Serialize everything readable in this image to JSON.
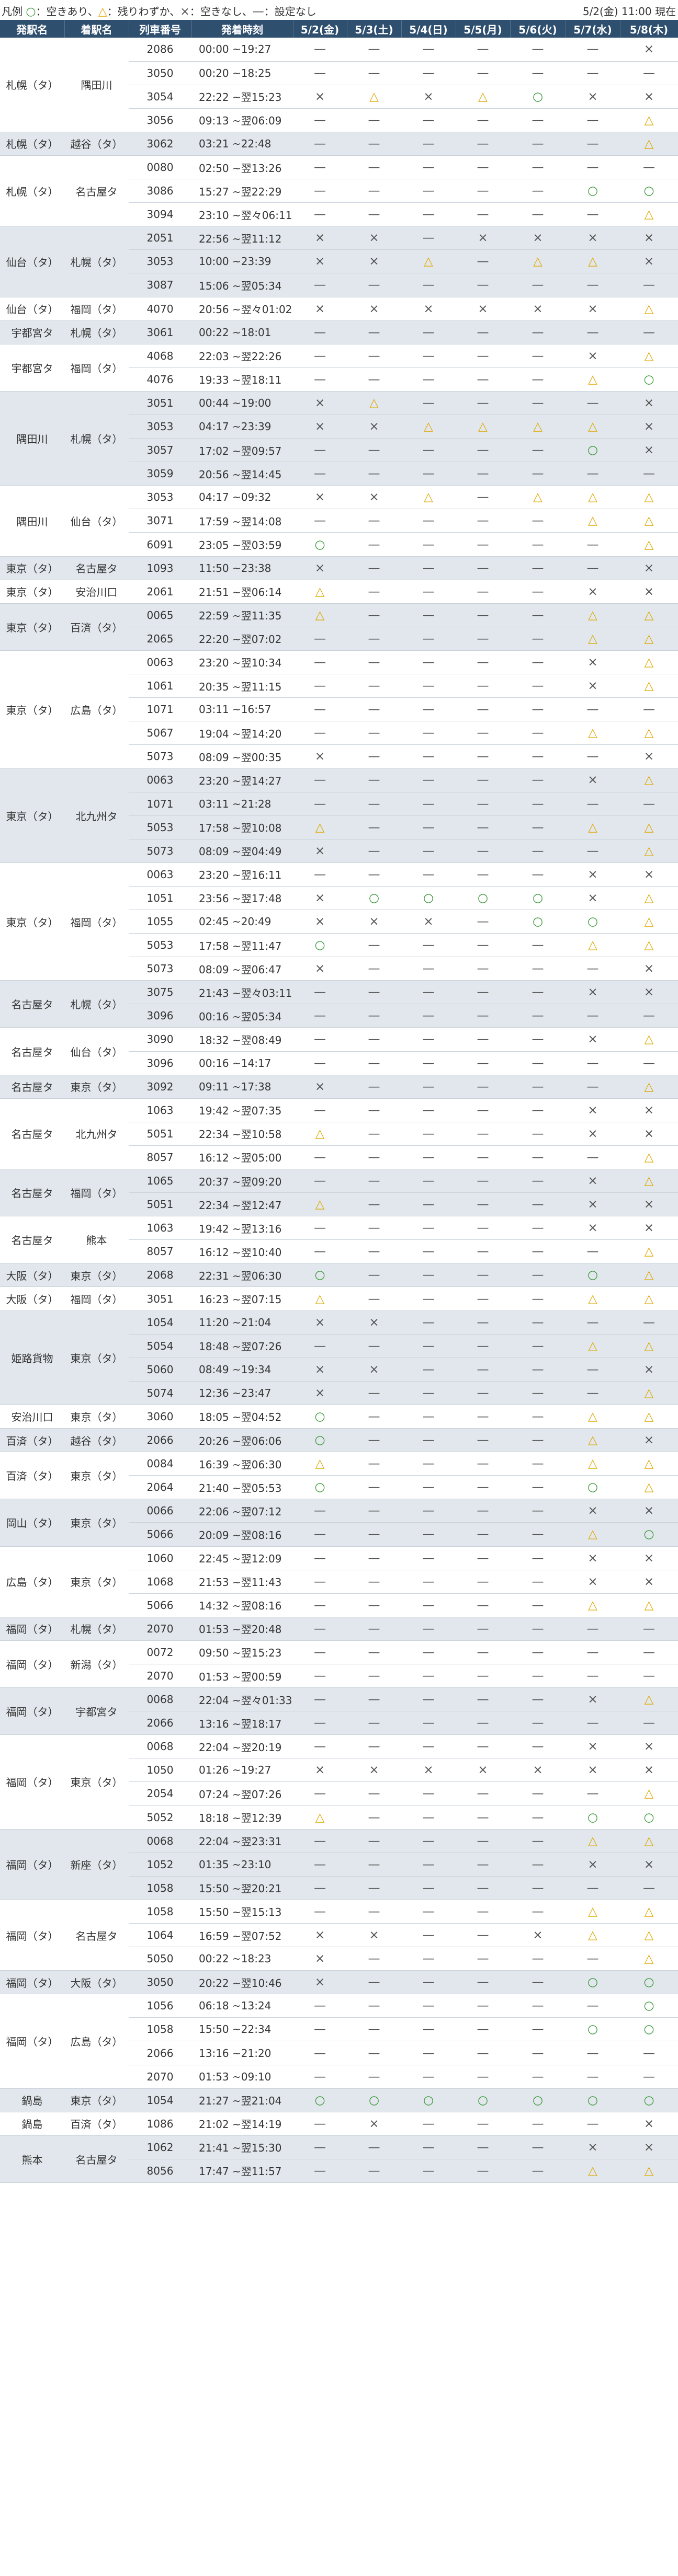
{
  "header": {
    "legend_label": "凡例",
    "legend_items": [
      {
        "symbol": "○",
        "text": "：空きあり、",
        "color": "#3b9a3b"
      },
      {
        "symbol": "△",
        "text": "：残りわずか、",
        "color": "#e0a800"
      },
      {
        "symbol": "×",
        "text": "：空きなし、",
        "color": "#555555"
      },
      {
        "symbol": "—",
        "text": "：設定なし",
        "color": "#555555"
      }
    ],
    "as_of": "5/2(金) 11:00 現在"
  },
  "columns": [
    "発駅名",
    "着駅名",
    "列車番号",
    "発着時刻",
    "5/2(金)",
    "5/3(土)",
    "5/4(日)",
    "5/5(月)",
    "5/6(火)",
    "5/7(水)",
    "5/8(木)"
  ],
  "groups": [
    {
      "from": "札幌（タ）",
      "to": "隅田川",
      "rows": [
        [
          "2086",
          "00:00 ~19:27",
          "—",
          "—",
          "—",
          "—",
          "—",
          "—",
          "×"
        ],
        [
          "3050",
          "00:20 ~18:25",
          "—",
          "—",
          "—",
          "—",
          "—",
          "—",
          "—"
        ],
        [
          "3054",
          "22:22 ~翌15:23",
          "×",
          "△",
          "×",
          "△",
          "○",
          "×",
          "×"
        ],
        [
          "3056",
          "09:13 ~翌06:09",
          "—",
          "—",
          "—",
          "—",
          "—",
          "—",
          "△"
        ]
      ]
    },
    {
      "from": "札幌（タ）",
      "to": "越谷（タ）",
      "rows": [
        [
          "3062",
          "03:21 ~22:48",
          "—",
          "—",
          "—",
          "—",
          "—",
          "—",
          "△"
        ]
      ]
    },
    {
      "from": "札幌（タ）",
      "to": "名古屋タ",
      "rows": [
        [
          "0080",
          "02:50 ~翌13:26",
          "—",
          "—",
          "—",
          "—",
          "—",
          "—",
          "—"
        ],
        [
          "3086",
          "15:27 ~翌22:29",
          "—",
          "—",
          "—",
          "—",
          "—",
          "○",
          "○"
        ],
        [
          "3094",
          "23:10 ~翌々06:11",
          "—",
          "—",
          "—",
          "—",
          "—",
          "—",
          "△"
        ]
      ]
    },
    {
      "from": "仙台（タ）",
      "to": "札幌（タ）",
      "rows": [
        [
          "2051",
          "22:56 ~翌11:12",
          "×",
          "×",
          "—",
          "×",
          "×",
          "×",
          "×"
        ],
        [
          "3053",
          "10:00 ~23:39",
          "×",
          "×",
          "△",
          "—",
          "△",
          "△",
          "×"
        ],
        [
          "3087",
          "15:06 ~翌05:34",
          "—",
          "—",
          "—",
          "—",
          "—",
          "—",
          "—"
        ]
      ]
    },
    {
      "from": "仙台（タ）",
      "to": "福岡（タ）",
      "rows": [
        [
          "4070",
          "20:56 ~翌々01:02",
          "×",
          "×",
          "×",
          "×",
          "×",
          "×",
          "△"
        ]
      ]
    },
    {
      "from": "宇都宮タ",
      "to": "札幌（タ）",
      "rows": [
        [
          "3061",
          "00:22 ~18:01",
          "—",
          "—",
          "—",
          "—",
          "—",
          "—",
          "—"
        ]
      ]
    },
    {
      "from": "宇都宮タ",
      "to": "福岡（タ）",
      "rows": [
        [
          "4068",
          "22:03 ~翌22:26",
          "—",
          "—",
          "—",
          "—",
          "—",
          "×",
          "△"
        ],
        [
          "4076",
          "19:33 ~翌18:11",
          "—",
          "—",
          "—",
          "—",
          "—",
          "△",
          "○"
        ]
      ]
    },
    {
      "from": "隅田川",
      "to": "札幌（タ）",
      "rows": [
        [
          "3051",
          "00:44 ~19:00",
          "×",
          "△",
          "—",
          "—",
          "—",
          "—",
          "×"
        ],
        [
          "3053",
          "04:17 ~23:39",
          "×",
          "×",
          "△",
          "△",
          "△",
          "△",
          "×"
        ],
        [
          "3057",
          "17:02 ~翌09:57",
          "—",
          "—",
          "—",
          "—",
          "—",
          "○",
          "×"
        ],
        [
          "3059",
          "20:56 ~翌14:45",
          "—",
          "—",
          "—",
          "—",
          "—",
          "—",
          "—"
        ]
      ]
    },
    {
      "from": "隅田川",
      "to": "仙台（タ）",
      "rows": [
        [
          "3053",
          "04:17 ~09:32",
          "×",
          "×",
          "△",
          "—",
          "△",
          "△",
          "△"
        ],
        [
          "3071",
          "17:59 ~翌14:08",
          "—",
          "—",
          "—",
          "—",
          "—",
          "△",
          "△"
        ],
        [
          "6091",
          "23:05 ~翌03:59",
          "○",
          "—",
          "—",
          "—",
          "—",
          "—",
          "△"
        ]
      ]
    },
    {
      "from": "東京（タ）",
      "to": "名古屋タ",
      "rows": [
        [
          "1093",
          "11:50 ~23:38",
          "×",
          "—",
          "—",
          "—",
          "—",
          "—",
          "×"
        ]
      ]
    },
    {
      "from": "東京（タ）",
      "to": "安治川口",
      "rows": [
        [
          "2061",
          "21:51 ~翌06:14",
          "△",
          "—",
          "—",
          "—",
          "—",
          "×",
          "×"
        ]
      ]
    },
    {
      "from": "東京（タ）",
      "to": "百済（タ）",
      "rows": [
        [
          "0065",
          "22:59 ~翌11:35",
          "△",
          "—",
          "—",
          "—",
          "—",
          "△",
          "△"
        ],
        [
          "2065",
          "22:20 ~翌07:02",
          "—",
          "—",
          "—",
          "—",
          "—",
          "△",
          "△"
        ]
      ]
    },
    {
      "from": "東京（タ）",
      "to": "広島（タ）",
      "rows": [
        [
          "0063",
          "23:20 ~翌10:34",
          "—",
          "—",
          "—",
          "—",
          "—",
          "×",
          "△"
        ],
        [
          "1061",
          "20:35 ~翌11:15",
          "—",
          "—",
          "—",
          "—",
          "—",
          "×",
          "△"
        ],
        [
          "1071",
          "03:11 ~16:57",
          "—",
          "—",
          "—",
          "—",
          "—",
          "—",
          "—"
        ],
        [
          "5067",
          "19:04 ~翌14:20",
          "—",
          "—",
          "—",
          "—",
          "—",
          "△",
          "△"
        ],
        [
          "5073",
          "08:09 ~翌00:35",
          "×",
          "—",
          "—",
          "—",
          "—",
          "—",
          "×"
        ]
      ]
    },
    {
      "from": "東京（タ）",
      "to": "北九州タ",
      "rows": [
        [
          "0063",
          "23:20 ~翌14:27",
          "—",
          "—",
          "—",
          "—",
          "—",
          "×",
          "△"
        ],
        [
          "1071",
          "03:11 ~21:28",
          "—",
          "—",
          "—",
          "—",
          "—",
          "—",
          "—"
        ],
        [
          "5053",
          "17:58 ~翌10:08",
          "△",
          "—",
          "—",
          "—",
          "—",
          "△",
          "△"
        ],
        [
          "5073",
          "08:09 ~翌04:49",
          "×",
          "—",
          "—",
          "—",
          "—",
          "—",
          "△"
        ]
      ]
    },
    {
      "from": "東京（タ）",
      "to": "福岡（タ）",
      "rows": [
        [
          "0063",
          "23:20 ~翌16:11",
          "—",
          "—",
          "—",
          "—",
          "—",
          "×",
          "×"
        ],
        [
          "1051",
          "23:56 ~翌17:48",
          "×",
          "○",
          "○",
          "○",
          "○",
          "×",
          "△"
        ],
        [
          "1055",
          "02:45 ~20:49",
          "×",
          "×",
          "×",
          "—",
          "○",
          "○",
          "△"
        ],
        [
          "5053",
          "17:58 ~翌11:47",
          "○",
          "—",
          "—",
          "—",
          "—",
          "△",
          "△"
        ],
        [
          "5073",
          "08:09 ~翌06:47",
          "×",
          "—",
          "—",
          "—",
          "—",
          "—",
          "×"
        ]
      ]
    },
    {
      "from": "名古屋タ",
      "to": "札幌（タ）",
      "rows": [
        [
          "3075",
          "21:43 ~翌々03:11",
          "—",
          "—",
          "—",
          "—",
          "—",
          "×",
          "×"
        ],
        [
          "3096",
          "00:16 ~翌05:34",
          "—",
          "—",
          "—",
          "—",
          "—",
          "—",
          "—"
        ]
      ]
    },
    {
      "from": "名古屋タ",
      "to": "仙台（タ）",
      "rows": [
        [
          "3090",
          "18:32 ~翌08:49",
          "—",
          "—",
          "—",
          "—",
          "—",
          "×",
          "△"
        ],
        [
          "3096",
          "00:16 ~14:17",
          "—",
          "—",
          "—",
          "—",
          "—",
          "—",
          "—"
        ]
      ]
    },
    {
      "from": "名古屋タ",
      "to": "東京（タ）",
      "rows": [
        [
          "3092",
          "09:11 ~17:38",
          "×",
          "—",
          "—",
          "—",
          "—",
          "—",
          "△"
        ]
      ]
    },
    {
      "from": "名古屋タ",
      "to": "北九州タ",
      "rows": [
        [
          "1063",
          "19:42 ~翌07:35",
          "—",
          "—",
          "—",
          "—",
          "—",
          "×",
          "×"
        ],
        [
          "5051",
          "22:34 ~翌10:58",
          "△",
          "—",
          "—",
          "—",
          "—",
          "×",
          "×"
        ],
        [
          "8057",
          "16:12 ~翌05:00",
          "—",
          "—",
          "—",
          "—",
          "—",
          "—",
          "△"
        ]
      ]
    },
    {
      "from": "名古屋タ",
      "to": "福岡（タ）",
      "rows": [
        [
          "1065",
          "20:37 ~翌09:20",
          "—",
          "—",
          "—",
          "—",
          "—",
          "×",
          "△"
        ],
        [
          "5051",
          "22:34 ~翌12:47",
          "△",
          "—",
          "—",
          "—",
          "—",
          "×",
          "×"
        ]
      ]
    },
    {
      "from": "名古屋タ",
      "to": "熊本",
      "rows": [
        [
          "1063",
          "19:42 ~翌13:16",
          "—",
          "—",
          "—",
          "—",
          "—",
          "×",
          "×"
        ],
        [
          "8057",
          "16:12 ~翌10:40",
          "—",
          "—",
          "—",
          "—",
          "—",
          "—",
          "△"
        ]
      ]
    },
    {
      "from": "大阪（タ）",
      "to": "東京（タ）",
      "rows": [
        [
          "2068",
          "22:31 ~翌06:30",
          "○",
          "—",
          "—",
          "—",
          "—",
          "○",
          "△"
        ]
      ]
    },
    {
      "from": "大阪（タ）",
      "to": "福岡（タ）",
      "rows": [
        [
          "3051",
          "16:23 ~翌07:15",
          "△",
          "—",
          "—",
          "—",
          "—",
          "△",
          "△"
        ]
      ]
    },
    {
      "from": "姫路貨物",
      "to": "東京（タ）",
      "rows": [
        [
          "1054",
          "11:20 ~21:04",
          "×",
          "×",
          "—",
          "—",
          "—",
          "—",
          "—"
        ],
        [
          "5054",
          "18:48 ~翌07:26",
          "—",
          "—",
          "—",
          "—",
          "—",
          "△",
          "△"
        ],
        [
          "5060",
          "08:49 ~19:34",
          "×",
          "×",
          "—",
          "—",
          "—",
          "—",
          "×"
        ],
        [
          "5074",
          "12:36 ~23:47",
          "×",
          "—",
          "—",
          "—",
          "—",
          "—",
          "△"
        ]
      ]
    },
    {
      "from": "安治川口",
      "to": "東京（タ）",
      "rows": [
        [
          "3060",
          "18:05 ~翌04:52",
          "○",
          "—",
          "—",
          "—",
          "—",
          "△",
          "△"
        ]
      ]
    },
    {
      "from": "百済（タ）",
      "to": "越谷（タ）",
      "rows": [
        [
          "2066",
          "20:26 ~翌06:06",
          "○",
          "—",
          "—",
          "—",
          "—",
          "△",
          "×"
        ]
      ]
    },
    {
      "from": "百済（タ）",
      "to": "東京（タ）",
      "rows": [
        [
          "0084",
          "16:39 ~翌06:30",
          "△",
          "—",
          "—",
          "—",
          "—",
          "△",
          "△"
        ],
        [
          "2064",
          "21:40 ~翌05:53",
          "○",
          "—",
          "—",
          "—",
          "—",
          "○",
          "△"
        ]
      ]
    },
    {
      "from": "岡山（タ）",
      "to": "東京（タ）",
      "rows": [
        [
          "0066",
          "22:06 ~翌07:12",
          "—",
          "—",
          "—",
          "—",
          "—",
          "×",
          "×"
        ],
        [
          "5066",
          "20:09 ~翌08:16",
          "—",
          "—",
          "—",
          "—",
          "—",
          "△",
          "○"
        ]
      ]
    },
    {
      "from": "広島（タ）",
      "to": "東京（タ）",
      "rows": [
        [
          "1060",
          "22:45 ~翌12:09",
          "—",
          "—",
          "—",
          "—",
          "—",
          "×",
          "×"
        ],
        [
          "1068",
          "21:53 ~翌11:43",
          "—",
          "—",
          "—",
          "—",
          "—",
          "×",
          "×"
        ],
        [
          "5066",
          "14:32 ~翌08:16",
          "—",
          "—",
          "—",
          "—",
          "—",
          "△",
          "△"
        ]
      ]
    },
    {
      "from": "福岡（タ）",
      "to": "札幌（タ）",
      "rows": [
        [
          "2070",
          "01:53 ~翌20:48",
          "—",
          "—",
          "—",
          "—",
          "—",
          "—",
          "—"
        ]
      ]
    },
    {
      "from": "福岡（タ）",
      "to": "新潟（タ）",
      "rows": [
        [
          "0072",
          "09:50 ~翌15:23",
          "—",
          "—",
          "—",
          "—",
          "—",
          "—",
          "—"
        ],
        [
          "2070",
          "01:53 ~翌00:59",
          "—",
          "—",
          "—",
          "—",
          "—",
          "—",
          "—"
        ]
      ]
    },
    {
      "from": "福岡（タ）",
      "to": "宇都宮タ",
      "rows": [
        [
          "0068",
          "22:04 ~翌々01:33",
          "—",
          "—",
          "—",
          "—",
          "—",
          "×",
          "△"
        ],
        [
          "2066",
          "13:16 ~翌18:17",
          "—",
          "—",
          "—",
          "—",
          "—",
          "—",
          "—"
        ]
      ]
    },
    {
      "from": "福岡（タ）",
      "to": "東京（タ）",
      "rows": [
        [
          "0068",
          "22:04 ~翌20:19",
          "—",
          "—",
          "—",
          "—",
          "—",
          "×",
          "×"
        ],
        [
          "1050",
          "01:26 ~19:27",
          "×",
          "×",
          "×",
          "×",
          "×",
          "×",
          "×"
        ],
        [
          "2054",
          "07:24 ~翌07:26",
          "—",
          "—",
          "—",
          "—",
          "—",
          "—",
          "△"
        ],
        [
          "5052",
          "18:18 ~翌12:39",
          "△",
          "—",
          "—",
          "—",
          "—",
          "○",
          "○"
        ]
      ]
    },
    {
      "from": "福岡（タ）",
      "to": "新座（タ）",
      "rows": [
        [
          "0068",
          "22:04 ~翌23:31",
          "—",
          "—",
          "—",
          "—",
          "—",
          "△",
          "△"
        ],
        [
          "1052",
          "01:35 ~23:10",
          "—",
          "—",
          "—",
          "—",
          "—",
          "×",
          "×"
        ],
        [
          "1058",
          "15:50 ~翌20:21",
          "—",
          "—",
          "—",
          "—",
          "—",
          "—",
          "—"
        ]
      ]
    },
    {
      "from": "福岡（タ）",
      "to": "名古屋タ",
      "rows": [
        [
          "1058",
          "15:50 ~翌15:13",
          "—",
          "—",
          "—",
          "—",
          "—",
          "△",
          "△"
        ],
        [
          "1064",
          "16:59 ~翌07:52",
          "×",
          "×",
          "—",
          "—",
          "×",
          "△",
          "△"
        ],
        [
          "5050",
          "00:22 ~18:23",
          "×",
          "—",
          "—",
          "—",
          "—",
          "—",
          "△"
        ]
      ]
    },
    {
      "from": "福岡（タ）",
      "to": "大阪（タ）",
      "rows": [
        [
          "3050",
          "20:22 ~翌10:46",
          "×",
          "—",
          "—",
          "—",
          "—",
          "○",
          "○"
        ]
      ]
    },
    {
      "from": "福岡（タ）",
      "to": "広島（タ）",
      "rows": [
        [
          "1056",
          "06:18 ~13:24",
          "—",
          "—",
          "—",
          "—",
          "—",
          "—",
          "○"
        ],
        [
          "1058",
          "15:50 ~22:34",
          "—",
          "—",
          "—",
          "—",
          "—",
          "○",
          "○"
        ],
        [
          "2066",
          "13:16 ~21:20",
          "—",
          "—",
          "—",
          "—",
          "—",
          "—",
          "—"
        ],
        [
          "2070",
          "01:53 ~09:10",
          "—",
          "—",
          "—",
          "—",
          "—",
          "—",
          "—"
        ]
      ]
    },
    {
      "from": "鍋島",
      "to": "東京（タ）",
      "rows": [
        [
          "1054",
          "21:27 ~翌21:04",
          "○",
          "○",
          "○",
          "○",
          "○",
          "○",
          "○"
        ]
      ]
    },
    {
      "from": "鍋島",
      "to": "百済（タ）",
      "rows": [
        [
          "1086",
          "21:02 ~翌14:19",
          "—",
          "×",
          "—",
          "—",
          "—",
          "—",
          "×"
        ]
      ]
    },
    {
      "from": "熊本",
      "to": "名古屋タ",
      "rows": [
        [
          "1062",
          "21:41 ~翌15:30",
          "—",
          "—",
          "—",
          "—",
          "—",
          "×",
          "×"
        ],
        [
          "8056",
          "17:47 ~翌11:57",
          "—",
          "—",
          "—",
          "—",
          "—",
          "△",
          "△"
        ]
      ]
    }
  ]
}
